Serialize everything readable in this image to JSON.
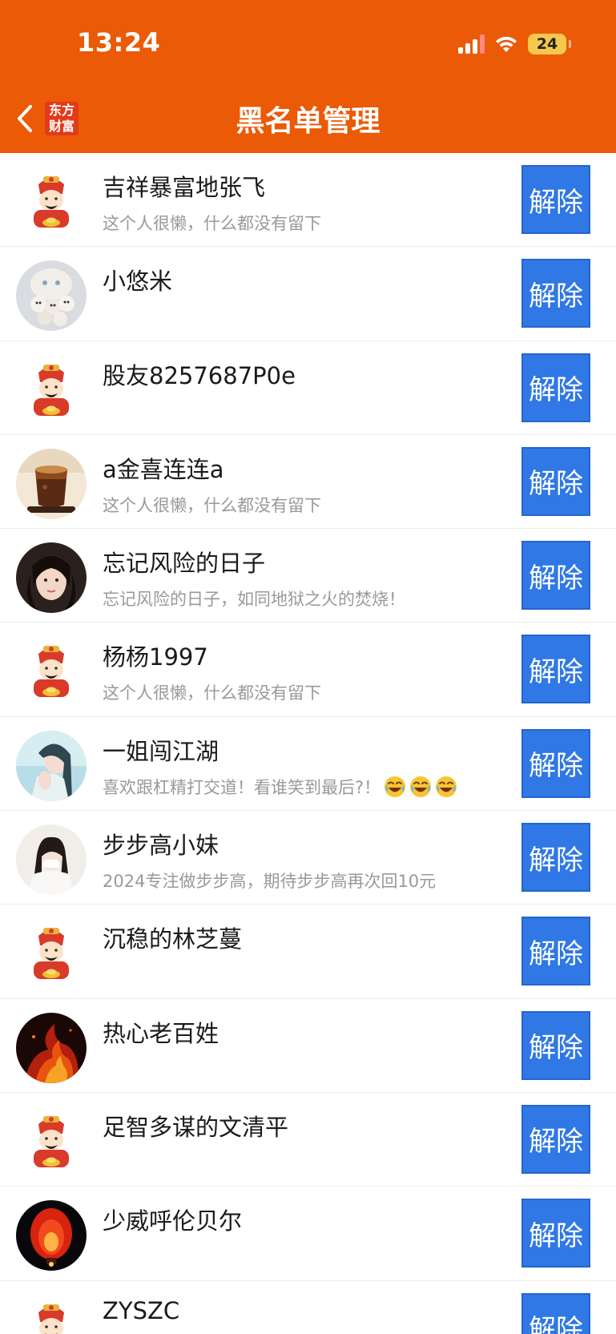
{
  "status_bar": {
    "time": "13:24",
    "battery": "24"
  },
  "header": {
    "title": "黑名单管理",
    "logo_line1": "东方",
    "logo_line2": "财富"
  },
  "unblock_label": "解除",
  "users": [
    {
      "name": "吉祥暴富地张飞",
      "signature": "这个人很懒，什么都没有留下",
      "avatar": "caishen"
    },
    {
      "name": "小悠米",
      "signature": "",
      "avatar": "cats"
    },
    {
      "name": "股友8257687P0e",
      "signature": "",
      "avatar": "caishen"
    },
    {
      "name": "a金喜连连a",
      "signature": "这个人很懒，什么都没有留下",
      "avatar": "drink"
    },
    {
      "name": "忘记风险的日子",
      "signature": "忘记风险的日子，如同地狱之火的焚烧！",
      "avatar": "girl-dark"
    },
    {
      "name": "杨杨1997",
      "signature": "这个人很懒，什么都没有留下",
      "avatar": "caishen"
    },
    {
      "name": "一姐闯江湖",
      "signature": "喜欢跟杠精打交道！看谁笑到最后?！",
      "signature_emojis": 3,
      "avatar": "girl-teal"
    },
    {
      "name": "步步高小妹",
      "signature": "2024专注做步步高，期待步步高再次回10元",
      "avatar": "girl-light"
    },
    {
      "name": "沉稳的林芝蔓",
      "signature": "",
      "avatar": "caishen"
    },
    {
      "name": "热心老百姓",
      "signature": "",
      "avatar": "fire"
    },
    {
      "name": "足智多谋的文清平",
      "signature": "",
      "avatar": "caishen"
    },
    {
      "name": "少威呼伦贝尔",
      "signature": "",
      "avatar": "lantern"
    },
    {
      "name": "ZYSZC",
      "signature": "",
      "avatar": "caishen"
    }
  ],
  "colors": {
    "header_bg": "#eb5a06",
    "button_bg": "#2f78e6"
  }
}
